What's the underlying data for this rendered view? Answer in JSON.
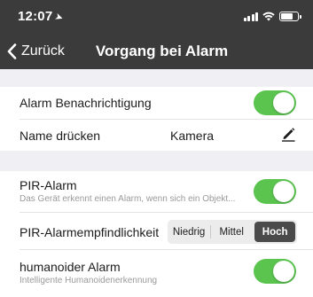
{
  "status_bar": {
    "time": "12:07"
  },
  "nav": {
    "back_label": "Zurück",
    "title": "Vorgang bei Alarm"
  },
  "rows": {
    "alarm_notification": {
      "label": "Alarm Benachrichtigung",
      "enabled": true
    },
    "name_press": {
      "label": "Name drücken",
      "value": "Kamera"
    },
    "pir_alarm": {
      "label": "PIR-Alarm",
      "subtitle": "Das Gerät erkennt einen Alarm, wenn sich ein Objekt...",
      "enabled": true
    },
    "pir_sensitivity": {
      "label": "PIR-Alarmempfindlichkeit",
      "options": [
        "Niedrig",
        "Mittel",
        "Hoch"
      ],
      "selected": "Hoch"
    },
    "humanoid_alarm": {
      "label": "humanoider Alarm",
      "subtitle": "Intelligente Humanoidenerkennung",
      "enabled": true
    }
  },
  "colors": {
    "header": "#3b3b3b",
    "toggle_on": "#5ac44f",
    "separator": "#efeff4",
    "segment_active": "#4a4a4a"
  }
}
